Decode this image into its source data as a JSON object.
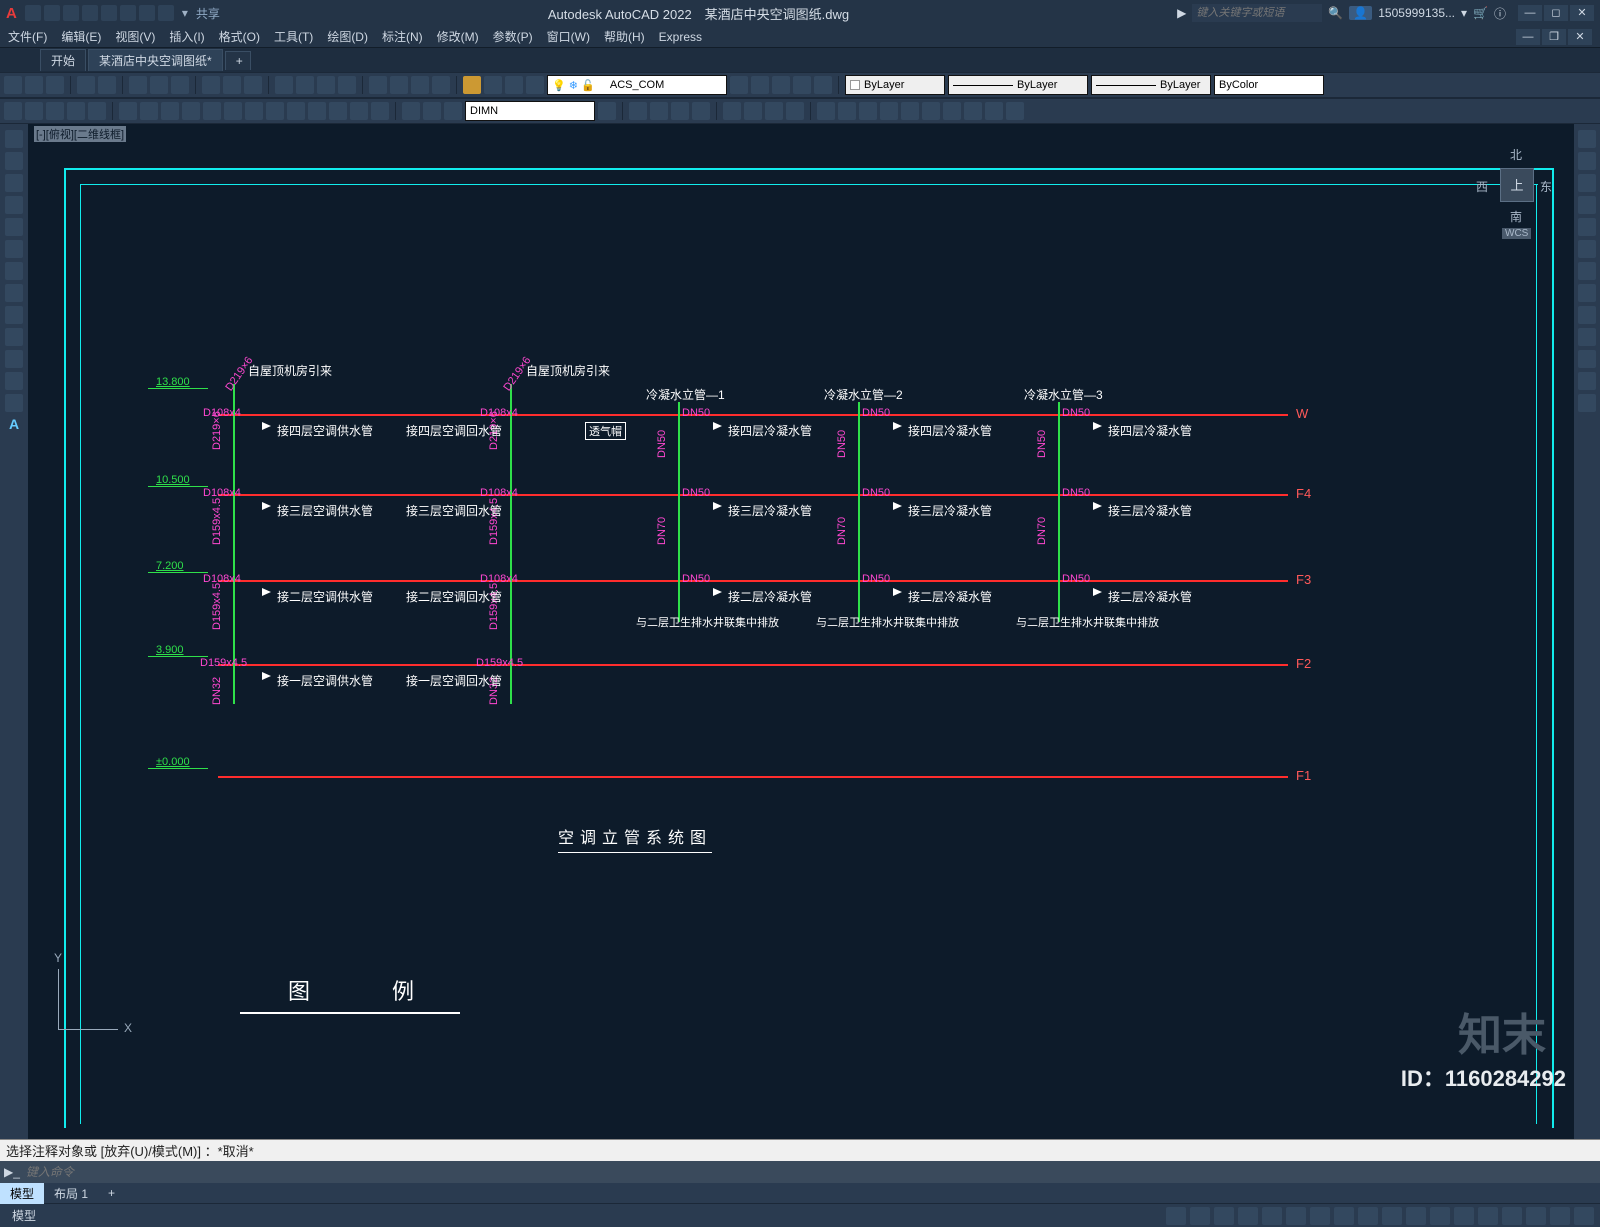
{
  "app": {
    "title_full": "Autodesk AutoCAD 2022　某酒店中央空调图纸.dwg",
    "share": "共享"
  },
  "search": {
    "placeholder": "键入关键字或短语",
    "user": "1505999135..."
  },
  "menus": [
    "文件(F)",
    "编辑(E)",
    "视图(V)",
    "插入(I)",
    "格式(O)",
    "工具(T)",
    "绘图(D)",
    "标注(N)",
    "修改(M)",
    "参数(P)",
    "窗口(W)",
    "帮助(H)",
    "Express"
  ],
  "file_tabs": {
    "start": "开始",
    "doc": "某酒店中央空调图纸*",
    "plus": "+"
  },
  "layer_combo": "ACS_COM",
  "prop_layer": "ByLayer",
  "prop_lt": "ByLayer",
  "prop_lw": "ByLayer",
  "prop_color": "ByColor",
  "dimstyle": "DIMN",
  "wcs": "WCS",
  "viewcube": {
    "top": "北",
    "left": "西",
    "right": "东",
    "bottom": "南",
    "face": "上"
  },
  "drawing": {
    "source1": "自屋顶机房引来",
    "source2": "自屋顶机房引来",
    "cols": {
      "c1": "冷凝水立管—1",
      "c2": "冷凝水立管—2",
      "c3": "冷凝水立管—3"
    },
    "vent": "透气帽",
    "elev": {
      "e1": "13.800",
      "e2": "10.500",
      "e3": "7.200",
      "e4": "3.900",
      "e5": "±0.000"
    },
    "floor": {
      "f1": "W",
      "f2": "F4",
      "f3": "F3",
      "f4": "F2",
      "f5": "F1"
    },
    "pipe": {
      "d219": "D219×6",
      "d108": "D108x4",
      "d159": "D159x4.5",
      "dn50": "DN50",
      "dn70": "DN70",
      "dn32": "DN32"
    },
    "txt": {
      "g4": "接四层空调供水管",
      "h4": "接四层空调回水管",
      "g3": "接三层空调供水管",
      "h3": "接三层空调回水管",
      "g2": "接二层空调供水管",
      "h2": "接二层空调回水管",
      "g1": "接一层空调供水管",
      "h1": "接一层空调回水管",
      "l4": "接四层冷凝水管",
      "l3": "接三层冷凝水管",
      "l2": "接二层冷凝水管",
      "drain": "与二层卫生排水井联集中排放"
    },
    "title": "空调立管系统图",
    "legend": "图　例"
  },
  "cmd": {
    "history": "选择注释对象或  [放弃(U)/模式(M)] ：*取消*",
    "prompt": "键入命令"
  },
  "tabs": {
    "model": "模型",
    "layout": "布局 1"
  },
  "statusbar_model": "模型",
  "id": "ID：1160284292",
  "wmk": "知末"
}
